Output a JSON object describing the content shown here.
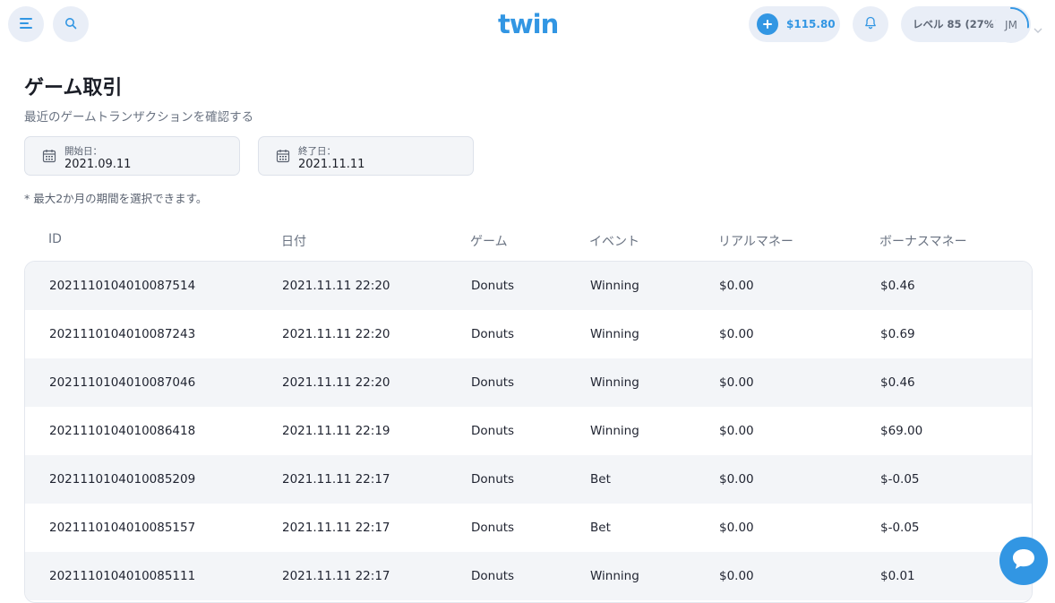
{
  "header": {
    "logo": "twin",
    "balance": "$115.80",
    "level_text": "レベル 85 (27%)",
    "level_progress": 0.27,
    "avatar_initials": "JM",
    "accent_color": "#3296e3",
    "icons": [
      "menu-icon",
      "search-icon",
      "plus-icon",
      "bell-icon",
      "chevron-down-icon"
    ]
  },
  "page": {
    "title": "ゲーム取引",
    "subtitle": "最近のゲームトランザクションを確認する",
    "start_date": {
      "label": "開始日：",
      "value": "2021.09.11"
    },
    "end_date": {
      "label": "終了日：",
      "value": "2021.11.11"
    },
    "note": "* 最大2か月の期間を選択できます。"
  },
  "table": {
    "columns": [
      "ID",
      "日付",
      "ゲーム",
      "イベント",
      "リアルマネー",
      "ボーナスマネー"
    ],
    "rows": [
      [
        "2021110104010087514",
        "2021.11.11 22:20",
        "Donuts",
        "Winning",
        "$0.00",
        "$0.46"
      ],
      [
        "2021110104010087243",
        "2021.11.11 22:20",
        "Donuts",
        "Winning",
        "$0.00",
        "$0.69"
      ],
      [
        "2021110104010087046",
        "2021.11.11 22:20",
        "Donuts",
        "Winning",
        "$0.00",
        "$0.46"
      ],
      [
        "2021110104010086418",
        "2021.11.11 22:19",
        "Donuts",
        "Winning",
        "$0.00",
        "$69.00"
      ],
      [
        "2021110104010085209",
        "2021.11.11 22:17",
        "Donuts",
        "Bet",
        "$0.00",
        "$-0.05"
      ],
      [
        "2021110104010085157",
        "2021.11.11 22:17",
        "Donuts",
        "Bet",
        "$0.00",
        "$-0.05"
      ],
      [
        "2021110104010085111",
        "2021.11.11 22:17",
        "Donuts",
        "Winning",
        "$0.00",
        "$0.01"
      ]
    ]
  }
}
